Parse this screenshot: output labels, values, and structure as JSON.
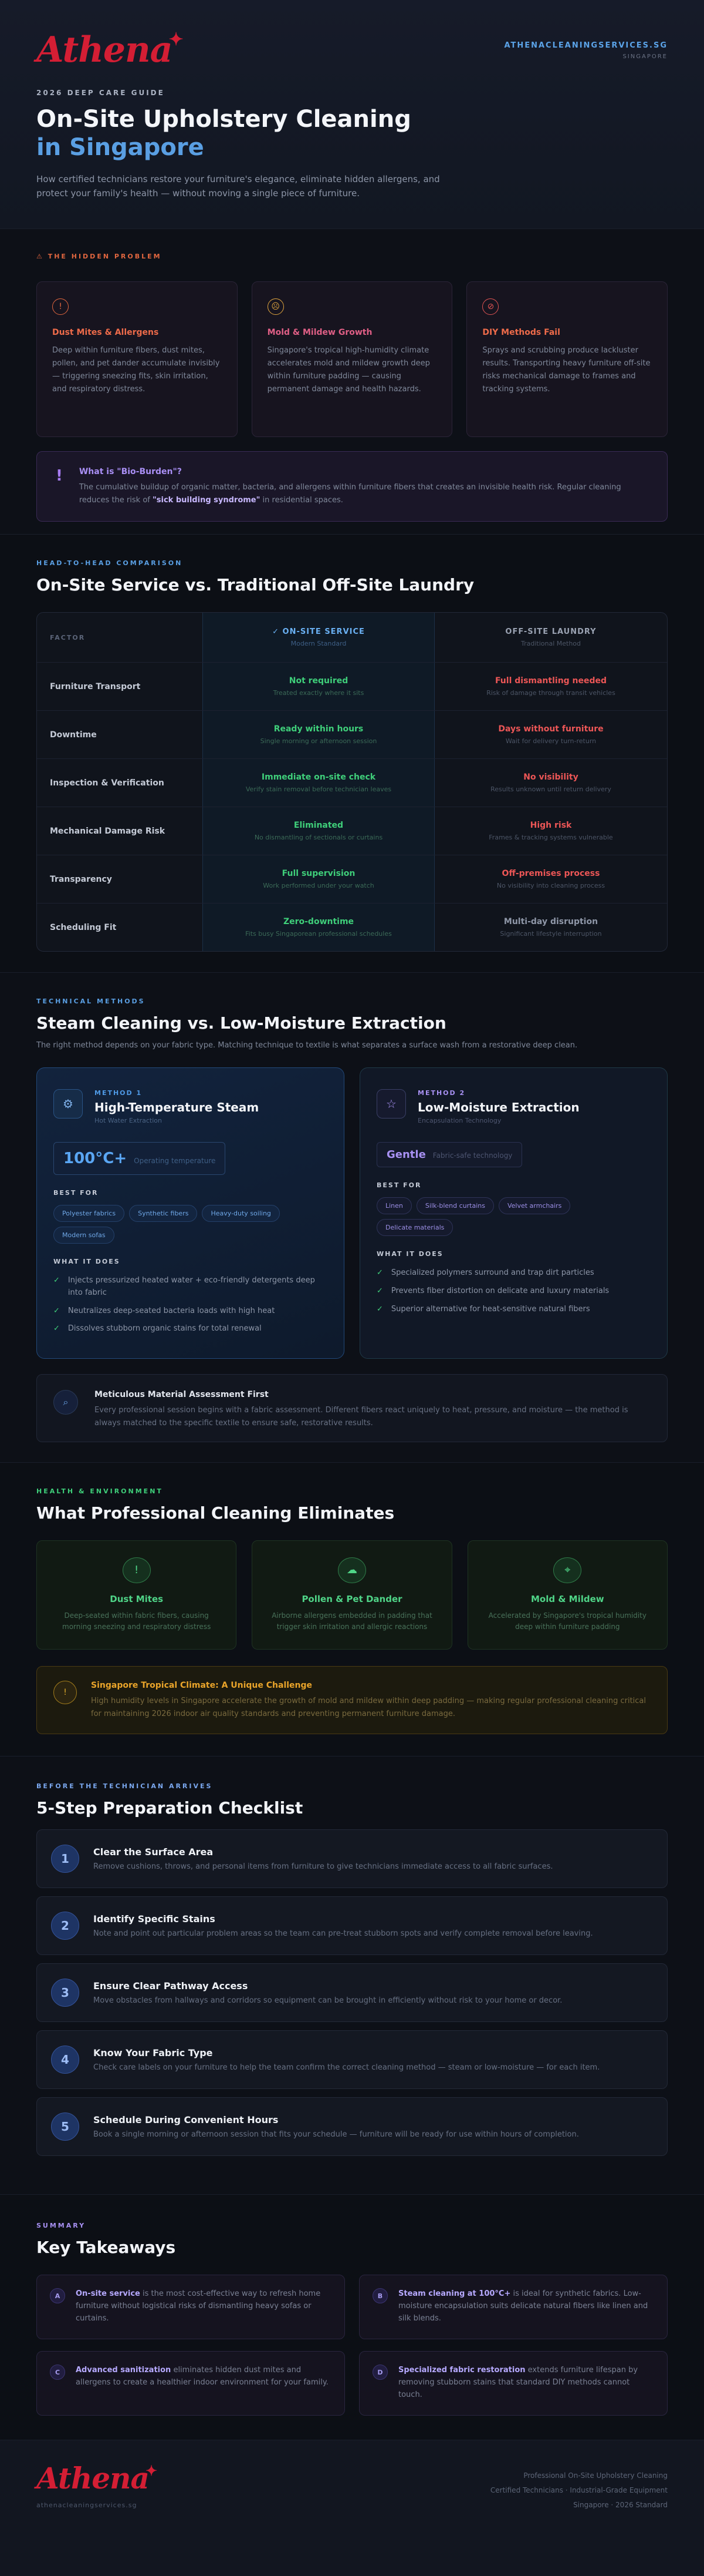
{
  "header": {
    "logo": "Athena",
    "site": "ATHENACLEANINGSERVICES.SG",
    "country": "SINGAPORE",
    "eyebrow": "2026 DEEP CARE GUIDE",
    "title_line1": "On-Site Upholstery Cleaning",
    "title_line2": "in Singapore",
    "lead": "How certified technicians restore your furniture's elegance, eliminate hidden allergens, and protect your family's health — without moving a single piece of furniture."
  },
  "problem": {
    "eyebrow": "THE HIDDEN PROBLEM",
    "cards": [
      {
        "title": "Dust Mites & Allergens",
        "text": "Deep within furniture fibers, dust mites, pollen, and pet dander accumulate invisibly — triggering sneezing fits, skin irritation, and respiratory distress."
      },
      {
        "title": "Mold & Mildew Growth",
        "text": "Singapore's tropical high-humidity climate accelerates mold and mildew growth deep within furniture padding — causing permanent damage and health hazards."
      },
      {
        "title": "DIY Methods Fail",
        "text": "Sprays and scrubbing produce lackluster results. Transporting heavy furniture off-site risks mechanical damage to frames and tracking systems."
      }
    ],
    "bio_title": "What is \"Bio-Burden\"?",
    "bio_text": "The cumulative buildup of organic matter, bacteria, and allergens within furniture fibers that creates an invisible health risk. Regular cleaning reduces the risk of ",
    "bio_bold": "\"sick building syndrome\"",
    "bio_tail": " in residential spaces."
  },
  "compare": {
    "eyebrow": "HEAD-TO-HEAD COMPARISON",
    "title": "On-Site Service vs. Traditional Off-Site Laundry",
    "head": {
      "factor": "FACTOR",
      "on": "✓ ON-SITE SERVICE",
      "on_sub": "Modern Standard",
      "off": "OFF-SITE LAUNDRY",
      "off_sub": "Traditional Method"
    },
    "rows": [
      {
        "factor": "Furniture Transport",
        "on": "Not required",
        "on_sub": "Treated exactly where it sits",
        "off": "Full dismantling needed",
        "off_sub": "Risk of damage through transit vehicles",
        "off_color": "red"
      },
      {
        "factor": "Downtime",
        "on": "Ready within hours",
        "on_sub": "Single morning or afternoon session",
        "off": "Days without furniture",
        "off_sub": "Wait for delivery turn-return",
        "off_color": "red"
      },
      {
        "factor": "Inspection & Verification",
        "on": "Immediate on-site check",
        "on_sub": "Verify stain removal before technician leaves",
        "off": "No visibility",
        "off_sub": "Results unknown until return delivery",
        "off_color": "red"
      },
      {
        "factor": "Mechanical Damage Risk",
        "on": "Eliminated",
        "on_sub": "No dismantling of sectionals or curtains",
        "off": "High risk",
        "off_sub": "Frames & tracking systems vulnerable",
        "off_color": "red"
      },
      {
        "factor": "Transparency",
        "on": "Full supervision",
        "on_sub": "Work performed under your watch",
        "off": "Off-premises process",
        "off_sub": "No visibility into cleaning process",
        "off_color": "red"
      },
      {
        "factor": "Scheduling Fit",
        "on": "Zero-downtime",
        "on_sub": "Fits busy Singaporean professional schedules",
        "off": "Multi-day disruption",
        "off_sub": "Significant lifestyle interruption",
        "off_color": "grey"
      }
    ]
  },
  "methods": {
    "eyebrow": "TECHNICAL METHODS",
    "title": "Steam Cleaning vs. Low-Moisture Extraction",
    "lead": "The right method depends on your fabric type. Matching technique to textile is what separates a surface wash from a restorative deep clean.",
    "m1": {
      "label": "METHOD 1",
      "title": "High-Temperature Steam",
      "sub": "Hot Water Extraction",
      "stat": "100°C+",
      "stat_sub": "Operating temperature",
      "best": "BEST FOR",
      "chips": [
        "Polyester fabrics",
        "Synthetic fibers",
        "Heavy-duty soiling",
        "Modern sofas"
      ],
      "what": "WHAT IT DOES",
      "checks": [
        "Injects pressurized heated water + eco-friendly detergents deep into fabric",
        "Neutralizes deep-seated bacteria loads with high heat",
        "Dissolves stubborn organic stains for total renewal"
      ]
    },
    "m2": {
      "label": "METHOD 2",
      "title": "Low-Moisture Extraction",
      "sub": "Encapsulation Technology",
      "stat": "Gentle",
      "stat_sub": "Fabric-safe technology",
      "best": "BEST FOR",
      "chips": [
        "Linen",
        "Silk-blend curtains",
        "Velvet armchairs",
        "Delicate materials"
      ],
      "what": "WHAT IT DOES",
      "checks": [
        "Specialized polymers surround and trap dirt particles",
        "Prevents fiber distortion on delicate and luxury materials",
        "Superior alternative for heat-sensitive natural fibers"
      ]
    },
    "assess_title": "Meticulous Material Assessment First",
    "assess_text": "Every professional session begins with a fabric assessment. Different fibers react uniquely to heat, pressure, and moisture — the method is always matched to the specific textile to ensure safe, restorative results."
  },
  "health": {
    "eyebrow": "HEALTH & ENVIRONMENT",
    "title": "What Professional Cleaning Eliminates",
    "cards": [
      {
        "title": "Dust Mites",
        "text": "Deep-seated within fabric fibers, causing morning sneezing and respiratory distress"
      },
      {
        "title": "Pollen & Pet Dander",
        "text": "Airborne allergens embedded in padding that trigger skin irritation and allergic reactions"
      },
      {
        "title": "Mold & Mildew",
        "text": "Accelerated by Singapore's tropical humidity deep within furniture padding"
      }
    ],
    "climate_title": "Singapore Tropical Climate: A Unique Challenge",
    "climate_text": "High humidity levels in Singapore accelerate the growth of mold and mildew within deep padding — making regular professional cleaning critical for maintaining 2026 indoor air quality standards and preventing permanent furniture damage."
  },
  "checklist": {
    "eyebrow": "BEFORE THE TECHNICIAN ARRIVES",
    "title": "5-Step Preparation Checklist",
    "steps": [
      {
        "n": "1",
        "title": "Clear the Surface Area",
        "text": "Remove cushions, throws, and personal items from furniture to give technicians immediate access to all fabric surfaces."
      },
      {
        "n": "2",
        "title": "Identify Specific Stains",
        "text": "Note and point out particular problem areas so the team can pre-treat stubborn spots and verify complete removal before leaving."
      },
      {
        "n": "3",
        "title": "Ensure Clear Pathway Access",
        "text": "Move obstacles from hallways and corridors so equipment can be brought in efficiently without risk to your home or decor."
      },
      {
        "n": "4",
        "title": "Know Your Fabric Type",
        "text": "Check care labels on your furniture to help the team confirm the correct cleaning method — steam or low-moisture — for each item."
      },
      {
        "n": "5",
        "title": "Schedule During Convenient Hours",
        "text": "Book a single morning or afternoon session that fits your schedule — furniture will be ready for use within hours of completion."
      }
    ]
  },
  "summary": {
    "eyebrow": "SUMMARY",
    "title": "Key Takeaways",
    "items": [
      {
        "l": "A",
        "b": "On-site service",
        "t": " is the most cost-effective way to refresh home furniture without logistical risks of dismantling heavy sofas or curtains."
      },
      {
        "l": "B",
        "b": "Steam cleaning at 100°C+",
        "t": " is ideal for synthetic fabrics. Low-moisture encapsulation suits delicate natural fibers like linen and silk blends."
      },
      {
        "l": "C",
        "b": "Advanced sanitization",
        "t": " eliminates hidden dust mites and allergens to create a healthier indoor environment for your family."
      },
      {
        "l": "D",
        "b": "Specialized fabric restoration",
        "t": " extends furniture lifespan by removing stubborn stains that standard DIY methods cannot touch."
      }
    ]
  },
  "footer": {
    "logo": "Athena",
    "url": "athenacleaningservices.sg",
    "r1": "Professional On-Site Upholstery Cleaning",
    "r2": "Certified Technicians · Industrial-Grade Equipment",
    "r3": "Singapore · 2026 Standard"
  },
  "colors": {
    "brand": "#d41e34",
    "accent": "#5a9fe3",
    "green": "#3fcf7a",
    "red": "#ec5656",
    "purple": "#a891f3",
    "amber": "#e9a42a"
  }
}
